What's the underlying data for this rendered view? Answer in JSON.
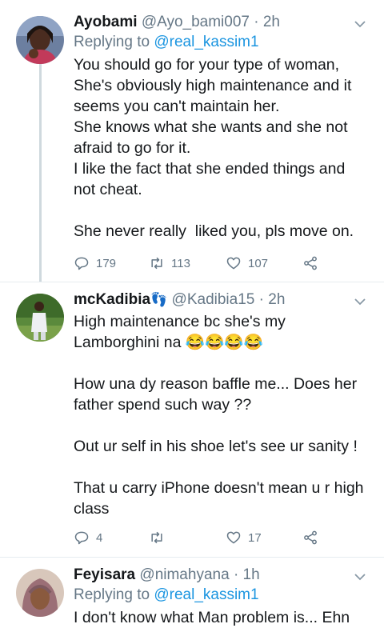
{
  "tweets": [
    {
      "name": "Ayobami",
      "handle": "@Ayo_bami007",
      "dot": "·",
      "time": "2h",
      "reply_prefix": "Replying to",
      "reply_mention": "@real_kassim1",
      "lines": [
        "You should go for your type of woman,",
        "She's obviously high maintenance and it seems you can't maintain her.",
        "She knows what she wants and she not afraid to go for it.",
        "I like the fact that she ended things and not cheat.",
        "",
        "She never really  liked you, pls move on."
      ],
      "replies": "179",
      "retweets": "113",
      "likes": "107"
    },
    {
      "name": "mcKadibia",
      "name_emoji": "👣",
      "handle": "@Kadibia15",
      "dot": "·",
      "time": "2h",
      "lines": [
        "High maintenance bc she's my Lamborghini na 😂😂😂😂",
        "",
        "How una dy reason baffle me... Does her father spend such way ??",
        "",
        "Out ur self in his shoe let's see ur sanity !",
        "",
        "That u carry iPhone doesn't mean u r high class"
      ],
      "replies": "4",
      "retweets": "",
      "likes": "17"
    },
    {
      "name": "Feyisara",
      "handle": "@nimahyana",
      "dot": "·",
      "time": "1h",
      "reply_prefix": "Replying to",
      "reply_mention": "@real_kassim1",
      "lines": [
        "I don't know what Man problem is... Ehn"
      ]
    }
  ],
  "icons": {
    "reply": "reply-icon",
    "retweet": "retweet-icon",
    "like": "heart-icon",
    "share": "share-icon",
    "more": "chevron-down-icon"
  },
  "colors": {
    "text": "#14171a",
    "secondary": "#657786",
    "link": "#1b95e0",
    "divider": "#e6ecf0",
    "thread_line": "#cfd9de"
  }
}
